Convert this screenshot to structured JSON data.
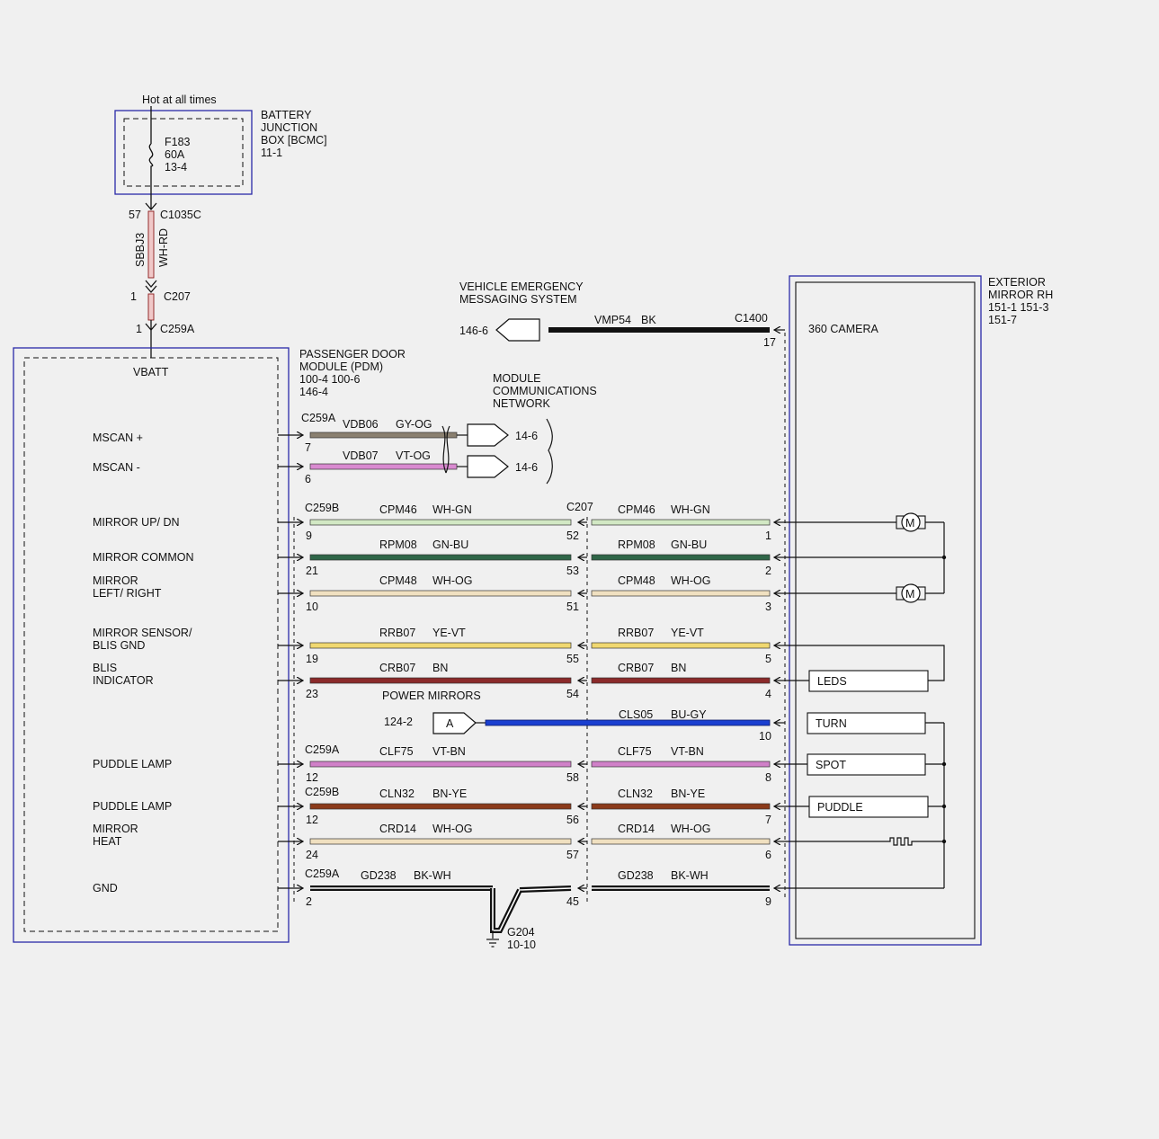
{
  "battery": {
    "hot_label": "Hot at all times",
    "title": [
      "BATTERY",
      "JUNCTION",
      "BOX [BCMC]",
      "11-1"
    ],
    "fuse_lines": [
      "F183",
      "60A",
      "13-4"
    ]
  },
  "feed": {
    "c1035c_pin": "57",
    "c1035c": "C1035C",
    "circuit": "SBBJ3",
    "color": "WH-RD",
    "c207_pin": "1",
    "c207": "C207",
    "c259a_pin": "1",
    "c259a": "C259A"
  },
  "pdm": {
    "title": [
      "PASSENGER DOOR",
      "MODULE (PDM)",
      "100-4   100-6",
      "146-4"
    ],
    "vbatt": "VBATT"
  },
  "vems": {
    "title": [
      "VEHICLE EMERGENCY",
      "MESSAGING SYSTEM"
    ],
    "ref": "146-6",
    "circuit": "VMP54",
    "color": "BK",
    "connector": "C1400",
    "pin": "17"
  },
  "mcn": {
    "title": [
      "MODULE",
      "COMMUNICATIONS",
      "NETWORK"
    ],
    "connector": "C259A",
    "lines": [
      {
        "circuit": "VDB06",
        "color": "GY-OG",
        "pin": "7",
        "ref": "14-6",
        "hex": "#8a8070"
      },
      {
        "circuit": "VDB07",
        "color": "VT-OG",
        "pin": "6",
        "ref": "14-6",
        "hex": "#d98ad0"
      }
    ]
  },
  "mirror": {
    "title": [
      "EXTERIOR",
      "MIRROR RH",
      "151-1   151-3",
      "151-7"
    ],
    "camera": "360 CAMERA",
    "loads": [
      "LEDS",
      "TURN",
      "SPOT",
      "PUDDLE"
    ],
    "motor_symbol": "M"
  },
  "turn_feed": {
    "ref": "124-2",
    "connector": "A",
    "circuit": "CLS05",
    "color": "BU-GY",
    "pin": "10",
    "hex": "#1a3fd0"
  },
  "power_mirrors": "POWER MIRRORS",
  "ground": {
    "name": "G204",
    "ref": "10-10"
  },
  "c207_label": "C207",
  "circuits": [
    {
      "label": [
        "MIRROR UP/ DN"
      ],
      "conn": "C259B",
      "pin_left": "9",
      "circuit": "CPM46",
      "color": "WH-GN",
      "pin_mid": "52",
      "pin_right": "1",
      "hex": "#d2e8c4"
    },
    {
      "label": [
        "MIRROR COMMON"
      ],
      "conn": "",
      "pin_left": "21",
      "circuit": "RPM08",
      "color": "GN-BU",
      "pin_mid": "53",
      "pin_right": "2",
      "hex": "#2f6648"
    },
    {
      "label": [
        "MIRROR",
        "LEFT/ RIGHT"
      ],
      "conn": "",
      "pin_left": "10",
      "circuit": "CPM48",
      "color": "WH-OG",
      "pin_mid": "51",
      "pin_right": "3",
      "hex": "#f0e0c0"
    },
    {
      "label": [
        "MIRROR SENSOR/",
        "BLIS GND"
      ],
      "conn": "",
      "pin_left": "19",
      "circuit": "RRB07",
      "color": "YE-VT",
      "pin_mid": "55",
      "pin_right": "5",
      "hex": "#f0d870"
    },
    {
      "label": [
        "BLIS",
        "INDICATOR"
      ],
      "conn": "",
      "pin_left": "23",
      "circuit": "CRB07",
      "color": "BN",
      "pin_mid": "54",
      "pin_right": "4",
      "hex": "#8b2a2a"
    },
    {
      "label": [
        "PUDDLE LAMP"
      ],
      "conn": "C259A",
      "pin_left": "12",
      "circuit": "CLF75",
      "color": "VT-BN",
      "pin_mid": "58",
      "pin_right": "8",
      "hex": "#d080c8"
    },
    {
      "label": [
        "PUDDLE LAMP"
      ],
      "conn": "C259B",
      "pin_left": "12",
      "circuit": "CLN32",
      "color": "BN-YE",
      "pin_mid": "56",
      "pin_right": "7",
      "hex": "#8b3a1a"
    },
    {
      "label": [
        "MIRROR",
        "HEAT"
      ],
      "conn": "",
      "pin_left": "24",
      "circuit": "CRD14",
      "color": "WH-OG",
      "pin_mid": "57",
      "pin_right": "6",
      "hex": "#f0e0c0"
    },
    {
      "label": [
        "GND"
      ],
      "conn": "C259A",
      "pin_left": "2",
      "circuit": "GD238",
      "color": "BK-WH",
      "pin_mid": "45",
      "pin_right": "9",
      "hex": "#111111"
    }
  ]
}
